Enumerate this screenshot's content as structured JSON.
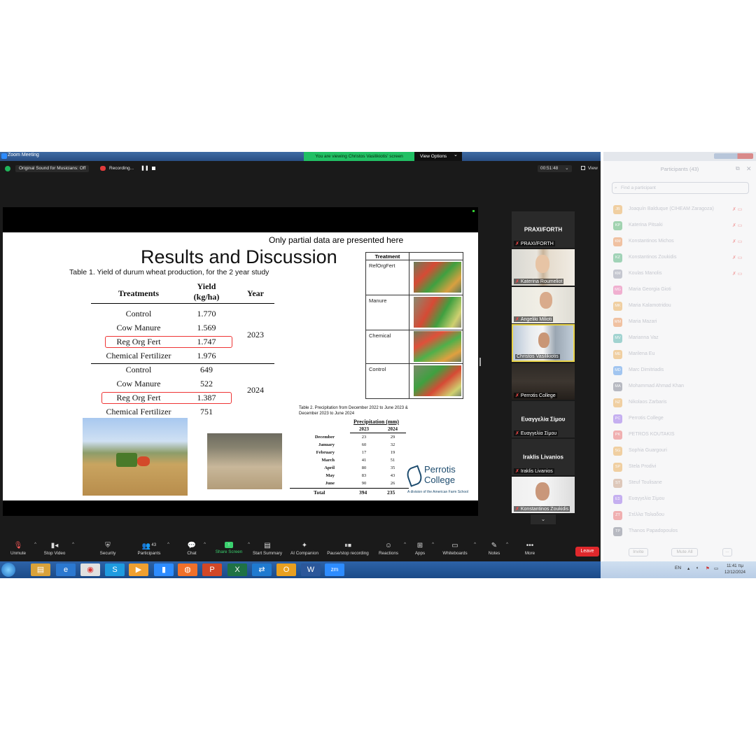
{
  "window": {
    "title": "Zoom Meeting",
    "viewing_banner": "You are viewing Christos Vasilikiotis' screen",
    "view_options": "View Options",
    "view_options_caret": "⌄"
  },
  "infobar": {
    "original_sound": "Original Sound for Musicians: Off",
    "recording": "Recording...",
    "pause_glyph": "❚❚",
    "timer": "00:51:48",
    "timer_caret": "⌄",
    "view": "View"
  },
  "slide": {
    "partial_note": "Only partial data are presented here",
    "heading": "Results and Discussion",
    "table1_caption": "Table 1.  Yield of durum wheat production, for the 2 year study",
    "table1": {
      "col_treatments": "Treatments",
      "col_yield": "Yield",
      "col_yield_unit": "(kg/ha)",
      "col_year": "Year",
      "groups": [
        {
          "year": "2023",
          "rows": [
            {
              "treatment": "Control",
              "yield": "1.770"
            },
            {
              "treatment": "Cow Manure",
              "yield": "1.569"
            },
            {
              "treatment": "Reg Org Fert",
              "yield": "1.747"
            },
            {
              "treatment": "Chemical Fertilizer",
              "yield": "1.976"
            }
          ]
        },
        {
          "year": "2024",
          "rows": [
            {
              "treatment": "Control",
              "yield": "649"
            },
            {
              "treatment": "Cow Manure",
              "yield": "522"
            },
            {
              "treatment": "Reg Org Fert",
              "yield": "1.387"
            },
            {
              "treatment": "Chemical Fertilizer",
              "yield": "751"
            }
          ]
        }
      ]
    },
    "treatment_table": {
      "header": "Treatment",
      "rows": [
        "RefOrgFert",
        "Manure",
        "Chemical",
        "Control"
      ]
    },
    "table2_caption": "Table 2. Precipitation from December 2022 to June 2023 & December 2023 to June 2024",
    "precip": {
      "title": "Precipitation (mm)",
      "years": [
        "2023",
        "2024"
      ],
      "rows": [
        {
          "month": "December",
          "v2023": "23",
          "v2024": "29"
        },
        {
          "month": "January",
          "v2023": "60",
          "v2024": "32"
        },
        {
          "month": "February",
          "v2023": "17",
          "v2024": "19"
        },
        {
          "month": "March",
          "v2023": "41",
          "v2024": "51"
        },
        {
          "month": "April",
          "v2023": "80",
          "v2024": "35"
        },
        {
          "month": "May",
          "v2023": "83",
          "v2024": "43"
        },
        {
          "month": "June",
          "v2023": "90",
          "v2024": "26"
        }
      ],
      "total_label": "Total",
      "total_2023": "394",
      "total_2024": "235"
    },
    "logo": {
      "line1": "Perrotis",
      "line2": "College",
      "division": "A division of the American Farm School"
    }
  },
  "gallery": {
    "tiles": [
      {
        "type": "name",
        "name": "PRAXI/FORTH",
        "label": "PRAXI/FORTH"
      },
      {
        "type": "video",
        "label": "Katerina Roumeliot"
      },
      {
        "type": "video",
        "label": "Angeliki Milioti"
      },
      {
        "type": "video",
        "label": "Christos Vasilikiotis"
      },
      {
        "type": "video",
        "label": "Perrotis College"
      },
      {
        "type": "name",
        "name": "Ευαγγελία Σίμου",
        "label": "Ευαγγελία Σίμου"
      },
      {
        "type": "name",
        "name": "Iraklis Livanios",
        "label": "Iraklis Livanios"
      },
      {
        "type": "video",
        "label": "Konstantinos Zoukidis"
      }
    ],
    "more_glyph": "⌄"
  },
  "toolbar": {
    "unmute": "Unmute",
    "stop_video": "Stop Video",
    "security": "Security",
    "participants": "Participants",
    "participants_count": "43",
    "chat": "Chat",
    "share_screen": "Share Screen",
    "start_summary": "Start Summary",
    "ai_companion": "AI Companion",
    "pause_recording": "Pause/stop recording",
    "reactions": "Reactions",
    "apps": "Apps",
    "whiteboards": "Whiteboards",
    "notes": "Notes",
    "more": "More",
    "leave": "Leave",
    "caret": "^"
  },
  "participants_panel": {
    "header": "Participants (43)",
    "find_placeholder": "Find a participant",
    "close_glyph": "✕",
    "popout_glyph": "⧉",
    "list": [
      {
        "initials": "JB",
        "name": "Joaquín Balduque (CIHEAM Zaragoza)",
        "color": "#e8a03a"
      },
      {
        "initials": "KP",
        "name": "Katerina Pitsaki",
        "color": "#3aa85a"
      },
      {
        "initials": "KM",
        "name": "Konstantinos Michos",
        "color": "#e8803a"
      },
      {
        "initials": "KZ",
        "name": "Konstantinos Zoukidis",
        "color": "#3aa86a"
      },
      {
        "initials": "KM",
        "name": "Koulas Manolis",
        "color": "#8a8fa0"
      },
      {
        "initials": "MG",
        "name": "Maria Georgia Gioti",
        "color": "#e85aa0"
      },
      {
        "initials": "MK",
        "name": "Maria Kalamotridou",
        "color": "#e8a03a"
      },
      {
        "initials": "MM",
        "name": "Maria Mazari",
        "color": "#e8803a"
      },
      {
        "initials": "MV",
        "name": "Marianna Vaz",
        "color": "#3aa8a0"
      },
      {
        "initials": "ME",
        "name": "Marilena Eu",
        "color": "#e8a03a"
      },
      {
        "initials": "MD",
        "name": "Marc Dimitriadis",
        "color": "#3a8ae8"
      },
      {
        "initials": "MA",
        "name": "Mohammad Ahmad Khan",
        "color": "#6a6f80"
      },
      {
        "initials": "NZ",
        "name": "Nikolaos Zarbaris",
        "color": "#e8a03a"
      },
      {
        "initials": "PC",
        "name": "Perrotis College",
        "color": "#8a5ae8"
      },
      {
        "initials": "PK",
        "name": "PETROS KOUTAKIS",
        "color": "#e85a5a"
      },
      {
        "initials": "SG",
        "name": "Sophia Guargouri",
        "color": "#e8a03a"
      },
      {
        "initials": "SP",
        "name": "Stela Prodivi",
        "color": "#e8a03a"
      },
      {
        "initials": "ST",
        "name": "Steuf Toulisane",
        "color": "#c09070"
      },
      {
        "initials": "EΣ",
        "name": "Ευαγγελία Σίμου",
        "color": "#8a5ae8"
      },
      {
        "initials": "ZT",
        "name": "Στέλλα Ταλιαδου",
        "color": "#e85a5a"
      },
      {
        "initials": "TP",
        "name": "Thanos Papadopoulos",
        "color": "#6a6f80"
      }
    ],
    "invite": "Invite",
    "mute_all": "Mute All",
    "more": "..."
  },
  "taskbar": {
    "lang": "EN",
    "time": "11:41 πμ",
    "date": "12/12/2024",
    "zoom_app": "zm"
  }
}
